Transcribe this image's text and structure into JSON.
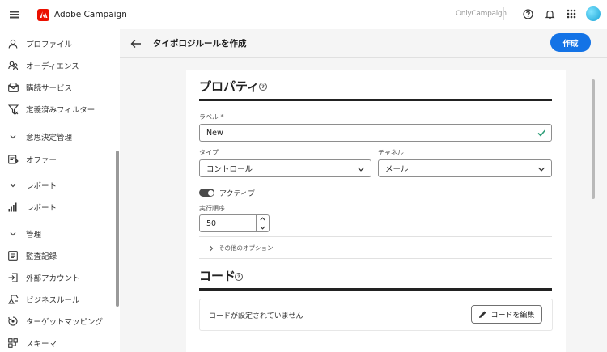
{
  "app": {
    "name": "Adobe Campaign",
    "org": "OnlyCampaign"
  },
  "topbar_icons": [
    "help-icon",
    "bell-icon",
    "apps-grid-icon",
    "avatar"
  ],
  "sidebar": {
    "items": [
      {
        "label": "プロファイル",
        "icon": "person-icon"
      },
      {
        "label": "オーディエンス",
        "icon": "audience-icon"
      },
      {
        "label": "購読サービス",
        "icon": "subscription-icon"
      },
      {
        "label": "定義済みフィルター",
        "icon": "filter-icon"
      }
    ],
    "sections": [
      {
        "label": "意思決定管理",
        "items": [
          {
            "label": "オファー",
            "icon": "offer-icon"
          }
        ]
      },
      {
        "label": "レポート",
        "items": [
          {
            "label": "レポート",
            "icon": "chart-icon"
          }
        ]
      },
      {
        "label": "管理",
        "items": [
          {
            "label": "監査記録",
            "icon": "audit-icon"
          },
          {
            "label": "外部アカウント",
            "icon": "external-account-icon"
          },
          {
            "label": "ビジネスルール",
            "icon": "business-rule-icon"
          },
          {
            "label": "ターゲットマッピング",
            "icon": "target-mapping-icon"
          },
          {
            "label": "スキーマ",
            "icon": "schema-icon"
          }
        ]
      }
    ]
  },
  "header": {
    "title": "タイポロジルールを作成",
    "create_label": "作成"
  },
  "properties": {
    "title": "プロパティ",
    "label_field": {
      "label": "ラベル",
      "required_mark": "*",
      "value": "New"
    },
    "type_field": {
      "label": "タイプ",
      "value": "コントロール"
    },
    "channel_field": {
      "label": "チャネル",
      "value": "メール"
    },
    "active": {
      "label": "アクティブ",
      "on": true
    },
    "order_field": {
      "label": "実行順序",
      "value": "50"
    },
    "more_options": "その他のオプション"
  },
  "code": {
    "title": "コード",
    "empty_text": "コードが設定されていません",
    "edit_label": "コードを編集"
  },
  "colors": {
    "accent": "#1473e6",
    "brand": "#eb1000",
    "valid": "#2d9d78"
  }
}
